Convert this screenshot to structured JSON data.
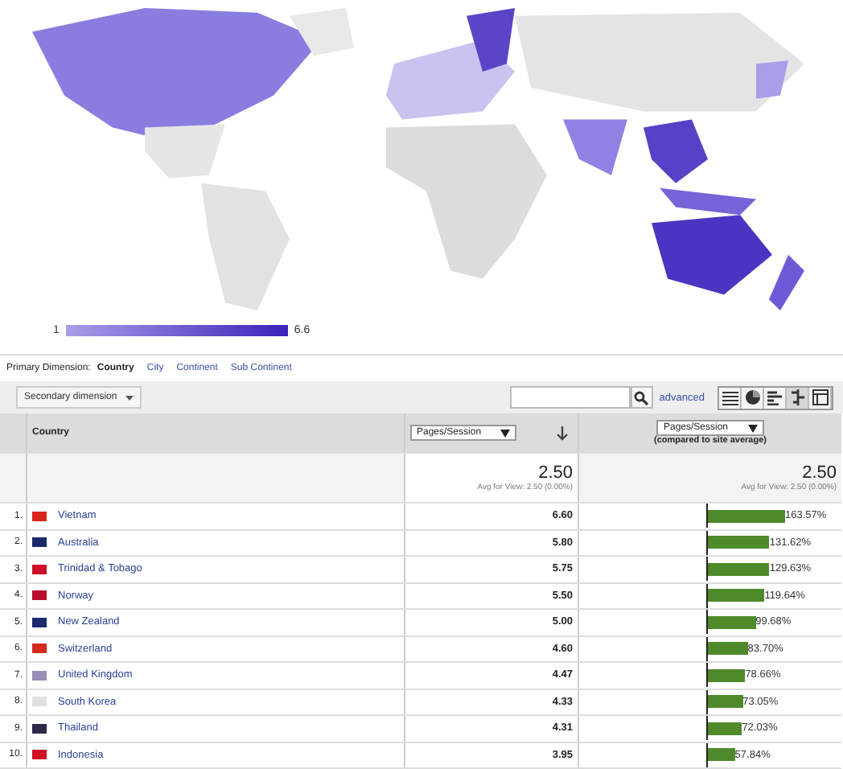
{
  "legend": {
    "min": "1",
    "max": "6.6"
  },
  "primary_dimension": {
    "label": "Primary Dimension:",
    "options": [
      {
        "label": "Country",
        "selected": true
      },
      {
        "label": "City",
        "selected": false
      },
      {
        "label": "Continent",
        "selected": false
      },
      {
        "label": "Sub Continent",
        "selected": false
      }
    ]
  },
  "toolbar": {
    "secondary_dimension": "Secondary dimension",
    "advanced": "advanced",
    "views": [
      {
        "kind": "table",
        "selected": false
      },
      {
        "kind": "pie",
        "selected": false
      },
      {
        "kind": "performance",
        "selected": false
      },
      {
        "kind": "comparison",
        "selected": true
      },
      {
        "kind": "pivot",
        "selected": false
      }
    ]
  },
  "table": {
    "columns": [
      "Country",
      "Pages/Session",
      "Pages/Session",
      "(compared to site average)"
    ],
    "summary": {
      "value": "2.50",
      "avg": "Avg for View: 2.50 (0.00%)",
      "compare_value": "2.50",
      "compare_avg": "Avg for View: 2.50 (0.00%)"
    },
    "rows": [
      {
        "index": "1.",
        "country": "Vietnam",
        "color": "#da251d",
        "value": "6.60",
        "percent": "163.57%",
        "level": 0.6
      },
      {
        "index": "2.",
        "country": "Australia",
        "color": "#1a2a6c",
        "value": "5.80",
        "percent": "131.62%",
        "level": 0.48
      },
      {
        "index": "3.",
        "country": "Trinidad & Tobago",
        "color": "#ce1126",
        "value": "5.75",
        "percent": "129.63%",
        "level": 0.48
      },
      {
        "index": "4.",
        "country": "Norway",
        "color": "#ba0c2f",
        "value": "5.50",
        "percent": "119.64%",
        "level": 0.44
      },
      {
        "index": "5.",
        "country": "New Zealand",
        "color": "#1a2a6c",
        "value": "5.00",
        "percent": "99.68%",
        "level": 0.37
      },
      {
        "index": "6.",
        "country": "Switzerland",
        "color": "#d52b1e",
        "value": "4.60",
        "percent": "83.70%",
        "level": 0.31
      },
      {
        "index": "7.",
        "country": "United Kingdom",
        "color": "#9a8fb5",
        "value": "4.47",
        "percent": "78.66%",
        "level": 0.29
      },
      {
        "index": "8.",
        "country": "South Korea",
        "color": "#e0e0e0",
        "value": "4.33",
        "percent": "73.05%",
        "level": 0.27
      },
      {
        "index": "9.",
        "country": "Thailand",
        "color": "#2d2a4a",
        "value": "4.31",
        "percent": "72.03%",
        "level": 0.265
      },
      {
        "index": "10.",
        "country": "Indonesia",
        "color": "#ce1126",
        "value": "3.95",
        "percent": "57.84%",
        "level": 0.21
      }
    ]
  }
}
